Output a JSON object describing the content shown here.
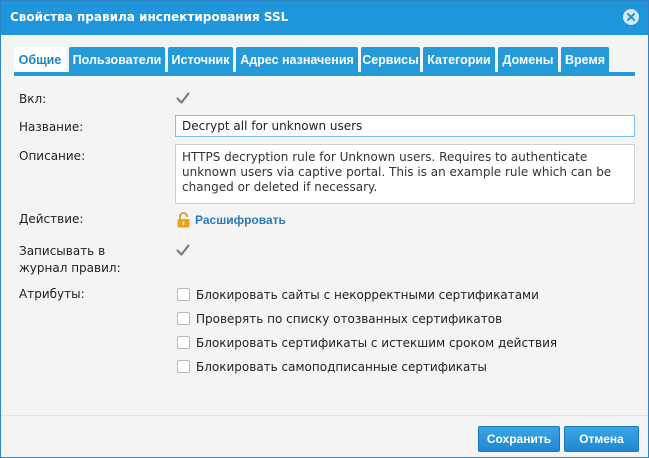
{
  "window": {
    "title": "Свойства правила инспектирования SSL"
  },
  "tabs": [
    {
      "label": "Общие",
      "active": true
    },
    {
      "label": "Пользователи"
    },
    {
      "label": "Источник"
    },
    {
      "label": "Адрес назначения"
    },
    {
      "label": "Сервисы"
    },
    {
      "label": "Категории"
    },
    {
      "label": "Домены"
    },
    {
      "label": "Время"
    }
  ],
  "form": {
    "enabled": {
      "label": "Вкл:",
      "checked": true
    },
    "name": {
      "label": "Название:",
      "value": "Decrypt all for unknown users"
    },
    "description": {
      "label": "Описание:",
      "value": "HTTPS decryption rule for Unknown users. Requires to authenticate unknown users via captive portal. This is an example rule which can be changed or deleted if necessary."
    },
    "action": {
      "label": "Действие:",
      "value": "Расшифровать",
      "icon": "unlock-icon"
    },
    "log": {
      "label_line1": "Записывать в",
      "label_line2": "журнал правил:",
      "checked": true
    },
    "attributes": {
      "label": "Атрибуты:",
      "items": [
        {
          "label": "Блокировать сайты с некорректными сертификатами",
          "checked": false
        },
        {
          "label": "Проверять по списку отозванных сертификатов",
          "checked": false
        },
        {
          "label": "Блокировать сертификаты с истекшим сроком действия",
          "checked": false
        },
        {
          "label": "Блокировать самоподписанные сертификаты",
          "checked": false
        }
      ]
    }
  },
  "footer": {
    "save_label": "Сохранить",
    "cancel_label": "Отмена"
  },
  "colors": {
    "titlebar": "#1f95dc",
    "tab": "#259ad9",
    "link": "#2a7bbd",
    "lock": "#f0a020"
  }
}
